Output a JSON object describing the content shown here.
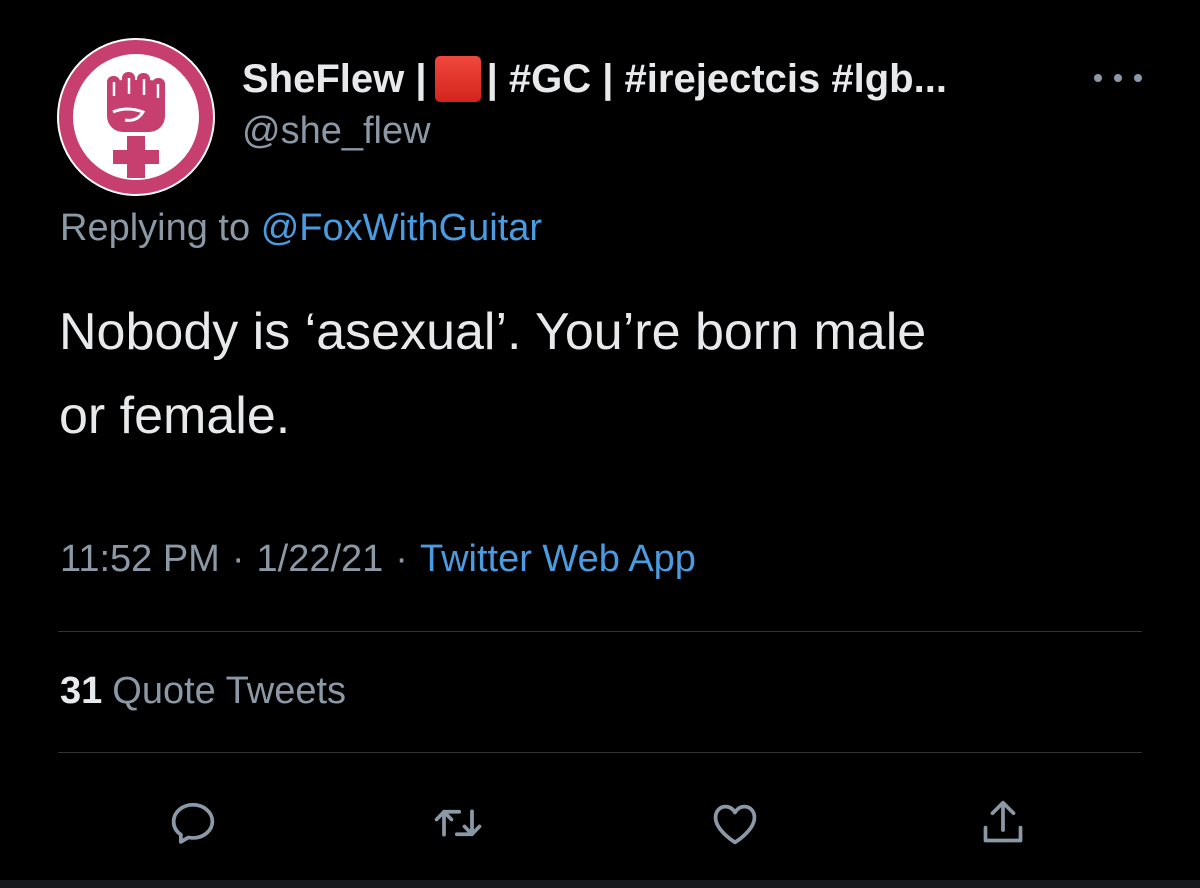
{
  "tweet": {
    "display_name_part1": "SheFlew |",
    "display_name_part2": "| #GC | #irejectcis #lgb...",
    "handle": "@she_flew",
    "reply_prefix": "Replying to",
    "reply_to": "@FoxWithGuitar",
    "text_line1": "Nobody is ‘asexual’. You’re born male",
    "text_line2": "or female.",
    "time": "11:52 PM",
    "date": "1/22/21",
    "source": "Twitter Web App",
    "meta_separator": "·",
    "quote_count": "31",
    "quote_label": "Quote Tweets"
  },
  "icons": {
    "avatar": "raised-fist-icon",
    "flag": "red-square-emoji",
    "more": "more-horizontal-icon",
    "reply": "reply-icon",
    "retweet": "retweet-icon",
    "like": "heart-icon",
    "share": "share-icon"
  },
  "colors": {
    "background": "#000000",
    "text_primary": "#e7e9ea",
    "text_secondary": "#8b98a5",
    "link": "#4a9be0",
    "divider": "#2f3336",
    "avatar_accent": "#c73f6e"
  }
}
